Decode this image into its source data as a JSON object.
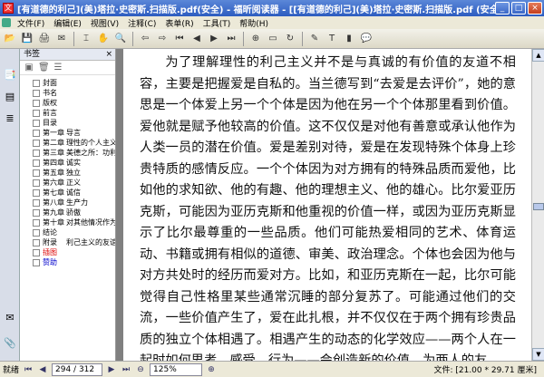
{
  "window": {
    "title": "[有道德的利己](美)塔拉·史密斯.扫描版.pdf(安全) - 福昕阅读器 - [[有道德的利己](美)塔拉·史密斯.扫描版.pdf (安全)]",
    "app_icon": "文"
  },
  "menu": [
    "文件(F)",
    "编辑(E)",
    "视图(V)",
    "注释(C)",
    "表单(R)",
    "工具(T)",
    "帮助(H)"
  ],
  "toolbar_icons": [
    "open-icon",
    "save-icon",
    "print-icon",
    "email-icon",
    "select-icon",
    "hand-icon",
    "zoom-icon",
    "back-icon",
    "forward-icon",
    "first-page-icon",
    "prev-page-icon",
    "next-page-icon",
    "last-page-icon",
    "zoom-in-icon",
    "fit-page-icon",
    "rotate-icon",
    "note-icon",
    "typewriter-icon",
    "highlight-icon",
    "comment-icon"
  ],
  "bookmarks": {
    "header": "书签",
    "close": "×",
    "items": [
      {
        "a": "封面",
        "b": ""
      },
      {
        "a": "书名",
        "b": ""
      },
      {
        "a": "版权",
        "b": ""
      },
      {
        "a": "前言",
        "b": ""
      },
      {
        "a": "目录",
        "b": ""
      },
      {
        "a": "第一章",
        "b": "导言"
      },
      {
        "a": "第二章",
        "b": "理性的个人主义"
      },
      {
        "a": "第三章",
        "b": "美德之所：功利"
      },
      {
        "a": "第四章",
        "b": "诚实"
      },
      {
        "a": "第五章",
        "b": "独立"
      },
      {
        "a": "第六章",
        "b": "正义"
      },
      {
        "a": "第七章",
        "b": "诚信"
      },
      {
        "a": "第八章",
        "b": "生产力"
      },
      {
        "a": "第九章",
        "b": "骄傲"
      },
      {
        "a": "第十章",
        "b": "对其他情况作为"
      },
      {
        "a": "结论",
        "b": ""
      },
      {
        "a": "附录",
        "b": "利己主义的友谊"
      },
      {
        "a": "插图",
        "b": "",
        "color": "red"
      },
      {
        "a": "赞助",
        "b": "",
        "color": "blue"
      }
    ]
  },
  "document": {
    "paragraphs": [
      "为了理解理性的利己主义并不是与真诚的有价值的友道不相容，主要是把握爱是自私的。当兰德写到“去爱是去评价”，她的意思是一个体爱上另一个个体是因为他在另一个个体那里看到价值。爱他就是赋予他较高的价值。这不仅仅是对他有善意或承认他作为人类一员的潜在价值。爱是差别对待，爱是在发现特殊个体身上珍贵特质的感情反应。一个个体因为对方拥有的特殊品质而爱他，比如他的求知欲、他的有趣、他的理想主义、他的雄心。比尔爱亚历克斯，可能因为亚历克斯和他重视的价值一样，或因为亚历克斯显示了比尔最尊重的一些品质。他们可能热爱相同的艺术、体育运动、书籍或拥有相似的道德、审美、政治理念。个体也会因为他与对方共处时的经历而爱对方。比如，和亚历克斯在一起，比尔可能觉得自己性格里某些通常沉睡的部分复苏了。可能通过他们的交流，一些价值产生了，爱在此扎根，并不仅仅在于两个拥有珍贵品质的独立个体相遇了。相遇产生的动态的化学效应——两个人在一起时如何思考、感受、行为——会创造新的价值。为两人的友"
    ]
  },
  "status": {
    "ready": "就绪",
    "page": "294 / 312",
    "zoom": "125%",
    "size": "文件: [21.00 * 29.71 厘米]"
  }
}
